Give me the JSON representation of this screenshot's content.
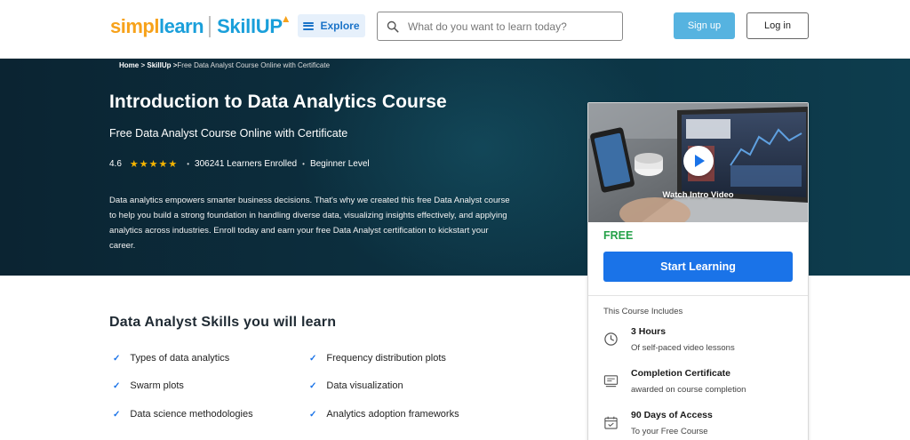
{
  "header": {
    "logo": {
      "simpli": "simpl",
      "learn": "learn",
      "skillup": "SkillUP"
    },
    "explore_label": "Explore",
    "search_placeholder": "What do you want to learn today?",
    "signup_label": "Sign up",
    "login_label": "Log in"
  },
  "breadcrumb": {
    "home": "Home",
    "sep1": " > ",
    "skillup": "SkillUp",
    "sep2": " >",
    "current": "Free Data Analyst Course Online with Certificate"
  },
  "hero": {
    "title": "Introduction to Data Analytics Course",
    "subtitle": "Free Data Analyst Course Online with Certificate",
    "rating": "4.6",
    "stars": 5,
    "learners": "306241 Learners Enrolled",
    "level": "Beginner Level",
    "description": "Data analytics empowers smarter business decisions. That's why we created this free Data Analyst course to help you build a strong foundation in handling diverse data, visualizing insights effectively, and applying analytics across industries. Enroll today and earn your free Data Analyst certification to kickstart your career."
  },
  "card": {
    "watch_label": "Watch Intro Video",
    "price": "FREE",
    "cta": "Start Learning",
    "includes_title": "This Course Includes",
    "includes": [
      {
        "icon": "clock-icon",
        "title": "3 Hours",
        "subtitle": "Of self-paced video lessons"
      },
      {
        "icon": "certificate-icon",
        "title": "Completion Certificate",
        "subtitle": "awarded on course completion"
      },
      {
        "icon": "calendar-icon",
        "title": "90 Days of Access",
        "subtitle": "To your Free Course"
      }
    ]
  },
  "skills": {
    "title": "Data Analyst Skills you will learn",
    "items": [
      "Types of data analytics",
      "Frequency distribution plots",
      "Swarm plots",
      "Data visualization",
      "Data science methodologies",
      "Analytics adoption frameworks"
    ]
  },
  "colors": {
    "brand_orange": "#f7a21b",
    "brand_blue": "#1a9fda",
    "primary_button": "#1a73e8",
    "signup_button": "#56b3e0",
    "free_green": "#24a148",
    "hero_bg": "#0c3242",
    "star_gold": "#f5b400"
  }
}
